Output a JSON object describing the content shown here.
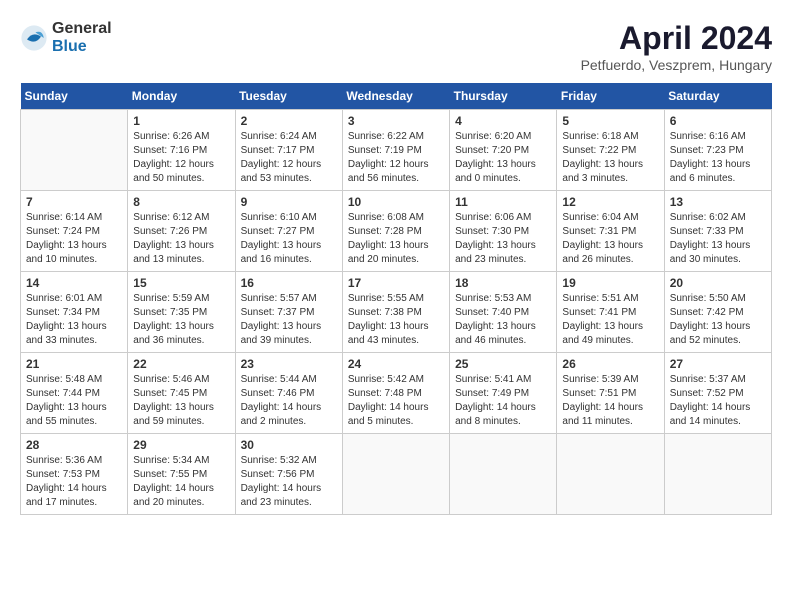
{
  "header": {
    "logo_general": "General",
    "logo_blue": "Blue",
    "month_title": "April 2024",
    "location": "Petfuerdo, Veszprem, Hungary"
  },
  "weekdays": [
    "Sunday",
    "Monday",
    "Tuesday",
    "Wednesday",
    "Thursday",
    "Friday",
    "Saturday"
  ],
  "weeks": [
    [
      {
        "day": "",
        "info": ""
      },
      {
        "day": "1",
        "info": "Sunrise: 6:26 AM\nSunset: 7:16 PM\nDaylight: 12 hours\nand 50 minutes."
      },
      {
        "day": "2",
        "info": "Sunrise: 6:24 AM\nSunset: 7:17 PM\nDaylight: 12 hours\nand 53 minutes."
      },
      {
        "day": "3",
        "info": "Sunrise: 6:22 AM\nSunset: 7:19 PM\nDaylight: 12 hours\nand 56 minutes."
      },
      {
        "day": "4",
        "info": "Sunrise: 6:20 AM\nSunset: 7:20 PM\nDaylight: 13 hours\nand 0 minutes."
      },
      {
        "day": "5",
        "info": "Sunrise: 6:18 AM\nSunset: 7:22 PM\nDaylight: 13 hours\nand 3 minutes."
      },
      {
        "day": "6",
        "info": "Sunrise: 6:16 AM\nSunset: 7:23 PM\nDaylight: 13 hours\nand 6 minutes."
      }
    ],
    [
      {
        "day": "7",
        "info": "Sunrise: 6:14 AM\nSunset: 7:24 PM\nDaylight: 13 hours\nand 10 minutes."
      },
      {
        "day": "8",
        "info": "Sunrise: 6:12 AM\nSunset: 7:26 PM\nDaylight: 13 hours\nand 13 minutes."
      },
      {
        "day": "9",
        "info": "Sunrise: 6:10 AM\nSunset: 7:27 PM\nDaylight: 13 hours\nand 16 minutes."
      },
      {
        "day": "10",
        "info": "Sunrise: 6:08 AM\nSunset: 7:28 PM\nDaylight: 13 hours\nand 20 minutes."
      },
      {
        "day": "11",
        "info": "Sunrise: 6:06 AM\nSunset: 7:30 PM\nDaylight: 13 hours\nand 23 minutes."
      },
      {
        "day": "12",
        "info": "Sunrise: 6:04 AM\nSunset: 7:31 PM\nDaylight: 13 hours\nand 26 minutes."
      },
      {
        "day": "13",
        "info": "Sunrise: 6:02 AM\nSunset: 7:33 PM\nDaylight: 13 hours\nand 30 minutes."
      }
    ],
    [
      {
        "day": "14",
        "info": "Sunrise: 6:01 AM\nSunset: 7:34 PM\nDaylight: 13 hours\nand 33 minutes."
      },
      {
        "day": "15",
        "info": "Sunrise: 5:59 AM\nSunset: 7:35 PM\nDaylight: 13 hours\nand 36 minutes."
      },
      {
        "day": "16",
        "info": "Sunrise: 5:57 AM\nSunset: 7:37 PM\nDaylight: 13 hours\nand 39 minutes."
      },
      {
        "day": "17",
        "info": "Sunrise: 5:55 AM\nSunset: 7:38 PM\nDaylight: 13 hours\nand 43 minutes."
      },
      {
        "day": "18",
        "info": "Sunrise: 5:53 AM\nSunset: 7:40 PM\nDaylight: 13 hours\nand 46 minutes."
      },
      {
        "day": "19",
        "info": "Sunrise: 5:51 AM\nSunset: 7:41 PM\nDaylight: 13 hours\nand 49 minutes."
      },
      {
        "day": "20",
        "info": "Sunrise: 5:50 AM\nSunset: 7:42 PM\nDaylight: 13 hours\nand 52 minutes."
      }
    ],
    [
      {
        "day": "21",
        "info": "Sunrise: 5:48 AM\nSunset: 7:44 PM\nDaylight: 13 hours\nand 55 minutes."
      },
      {
        "day": "22",
        "info": "Sunrise: 5:46 AM\nSunset: 7:45 PM\nDaylight: 13 hours\nand 59 minutes."
      },
      {
        "day": "23",
        "info": "Sunrise: 5:44 AM\nSunset: 7:46 PM\nDaylight: 14 hours\nand 2 minutes."
      },
      {
        "day": "24",
        "info": "Sunrise: 5:42 AM\nSunset: 7:48 PM\nDaylight: 14 hours\nand 5 minutes."
      },
      {
        "day": "25",
        "info": "Sunrise: 5:41 AM\nSunset: 7:49 PM\nDaylight: 14 hours\nand 8 minutes."
      },
      {
        "day": "26",
        "info": "Sunrise: 5:39 AM\nSunset: 7:51 PM\nDaylight: 14 hours\nand 11 minutes."
      },
      {
        "day": "27",
        "info": "Sunrise: 5:37 AM\nSunset: 7:52 PM\nDaylight: 14 hours\nand 14 minutes."
      }
    ],
    [
      {
        "day": "28",
        "info": "Sunrise: 5:36 AM\nSunset: 7:53 PM\nDaylight: 14 hours\nand 17 minutes."
      },
      {
        "day": "29",
        "info": "Sunrise: 5:34 AM\nSunset: 7:55 PM\nDaylight: 14 hours\nand 20 minutes."
      },
      {
        "day": "30",
        "info": "Sunrise: 5:32 AM\nSunset: 7:56 PM\nDaylight: 14 hours\nand 23 minutes."
      },
      {
        "day": "",
        "info": ""
      },
      {
        "day": "",
        "info": ""
      },
      {
        "day": "",
        "info": ""
      },
      {
        "day": "",
        "info": ""
      }
    ]
  ]
}
